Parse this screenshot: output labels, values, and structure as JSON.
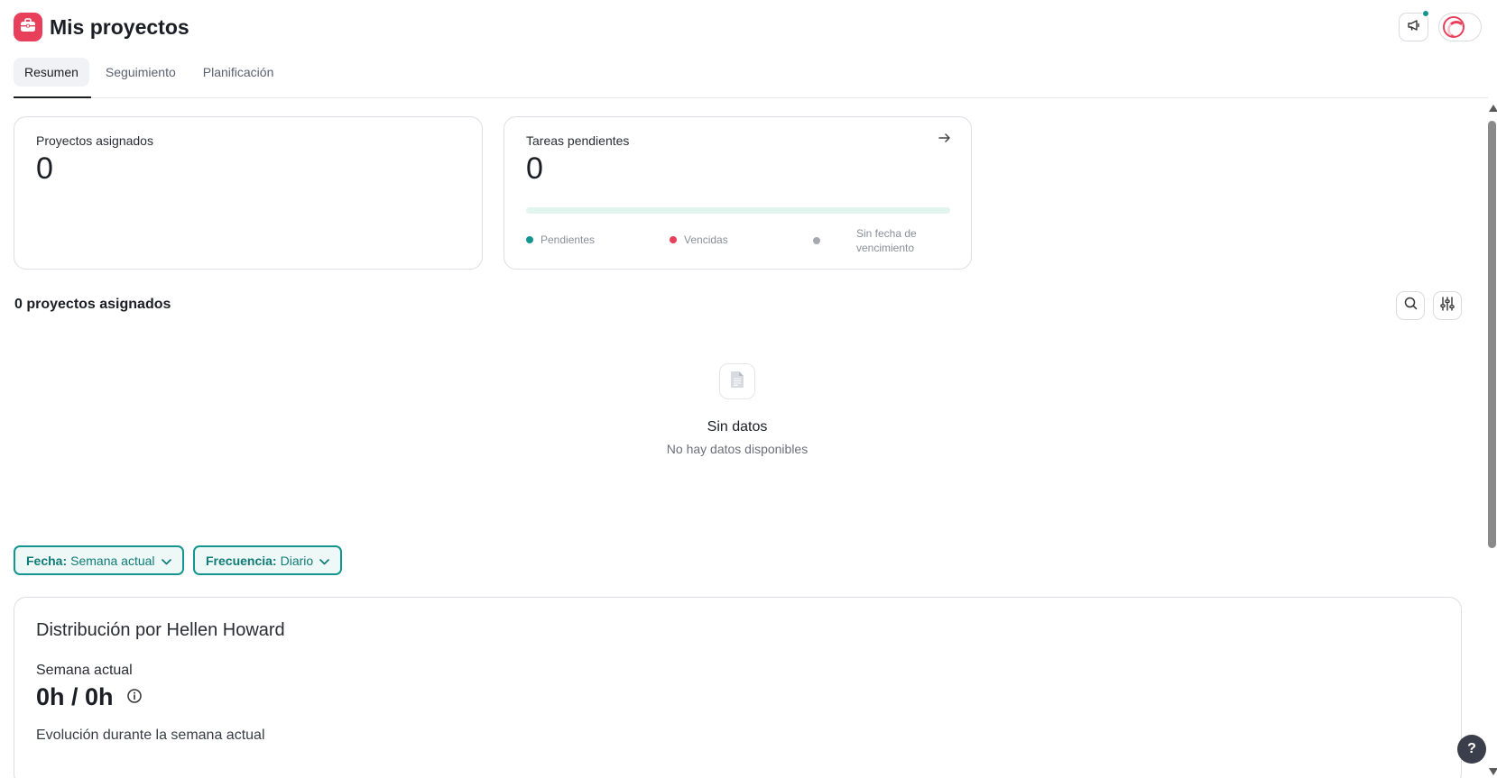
{
  "header": {
    "title": "Mis proyectos",
    "logo_icon": "briefcase-icon",
    "accent_color": "#e8405a",
    "notification_icon": "megaphone-icon",
    "notification_dot_color": "#14958f"
  },
  "tabs": [
    {
      "label": "Resumen",
      "active": true
    },
    {
      "label": "Seguimiento",
      "active": false
    },
    {
      "label": "Planificación",
      "active": false
    }
  ],
  "cards": {
    "projects": {
      "label": "Proyectos asignados",
      "value": "0"
    },
    "tasks": {
      "label": "Tareas pendientes",
      "value": "0",
      "progress_color": "#e2f4ee",
      "legend": [
        {
          "label": "Pendientes",
          "color": "#14958f"
        },
        {
          "label": "Vencidas",
          "color": "#e8405a"
        },
        {
          "label": "Sin fecha de vencimiento",
          "color": "#a6a9b0"
        }
      ]
    }
  },
  "projects_section": {
    "title": "0 proyectos asignados",
    "empty_title": "Sin datos",
    "empty_subtitle": "No hay datos disponibles"
  },
  "filters": {
    "date": {
      "label": "Fecha:",
      "value": "Semana actual"
    },
    "frequency": {
      "label": "Frecuencia:",
      "value": "Diario"
    }
  },
  "distribution": {
    "title": "Distribución por Hellen Howard",
    "period": "Semana actual",
    "hours": "0h / 0h",
    "evolution": "Evolución durante la semana actual"
  },
  "help": {
    "label": "?"
  }
}
